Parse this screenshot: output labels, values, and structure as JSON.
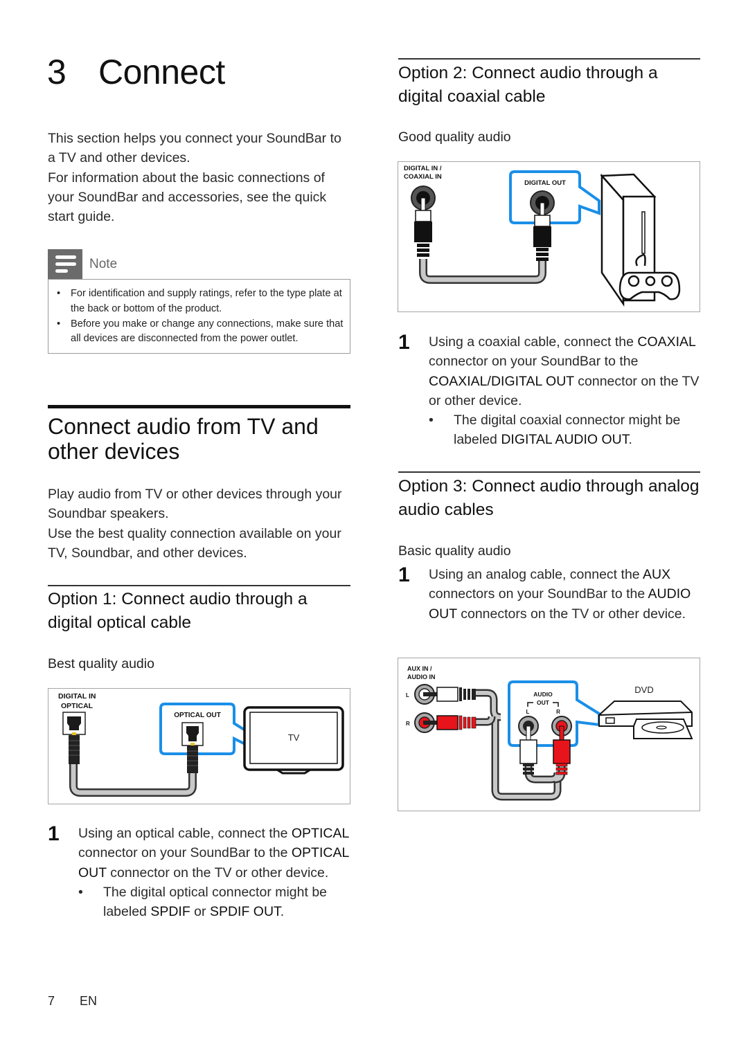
{
  "chapter": {
    "number": "3",
    "title": "Connect"
  },
  "intro": {
    "paragraph_1": "This section helps you connect your SoundBar to a TV and other devices.",
    "paragraph_2": "For information about the basic connections of your SoundBar and accessories, see the quick start guide."
  },
  "note": {
    "icon": "note-lines-icon",
    "label": "Note",
    "items": [
      "For identification and supply ratings, refer to the type plate at the back or bottom of the product.",
      "Before you make or change any connections, make sure that all devices are disconnected from the power outlet."
    ]
  },
  "section": {
    "title": "Connect audio from TV and other devices",
    "paragraph_1": "Play audio from TV or other devices through your Soundbar speakers.",
    "paragraph_2": "Use the best quality connection available on your TV, Soundbar, and other devices."
  },
  "option1": {
    "title": "Option 1: Connect audio through a digital optical cable",
    "quality": "Best quality audio",
    "figure": {
      "soundbar_label_1": "DIGITAL IN",
      "soundbar_label_2": "OPTICAL",
      "device_port_label": "OPTICAL OUT",
      "device_label": "TV",
      "highlight_color": "#1a8fe8"
    },
    "step": {
      "number": "1",
      "text_1": "Using an optical cable, connect the ",
      "key_1": "OPTICAL",
      "text_2": " connector on your SoundBar to the ",
      "key_2": "OPTICAL OUT",
      "text_3": " connector on the TV or other device."
    },
    "bullet": {
      "symbol": "•",
      "text_1": "The digital optical connector might be labeled ",
      "key_1": "SPDIF",
      "text_2": " or ",
      "key_2": "SPDIF OUT",
      "text_3": "."
    }
  },
  "option2": {
    "title": "Option 2: Connect audio through a digital coaxial cable",
    "quality": "Good quality audio",
    "figure": {
      "soundbar_label_1": "DIGITAL IN /",
      "soundbar_label_2": "COAXIAL IN",
      "device_port_label": "DIGITAL OUT",
      "device_label": "game console",
      "highlight_color": "#1a8fe8"
    },
    "step": {
      "number": "1",
      "text_1": "Using a coaxial cable, connect the ",
      "key_1": "COAXIAL",
      "text_2": " connector on your SoundBar to the ",
      "key_2": "COAXIAL/DIGITAL OUT",
      "text_3": " connector on the TV or other device."
    },
    "bullet": {
      "symbol": "•",
      "text_1": "The digital coaxial connector might be labeled ",
      "key_1": "DIGITAL AUDIO OUT",
      "text_2": "."
    }
  },
  "option3": {
    "title": "Option 3: Connect audio through analog audio cables",
    "quality": "Basic quality audio",
    "step": {
      "number": "1",
      "text_1": "Using an analog cable, connect the ",
      "key_1": "AUX",
      "text_2": " connectors on your SoundBar to the ",
      "key_2": "AUDIO OUT",
      "text_3": " connectors on the TV or other device."
    },
    "figure": {
      "soundbar_label_1": "AUX IN /",
      "soundbar_label_2": "AUDIO IN",
      "left": "L",
      "right": "R",
      "device_port_label_1": "AUDIO",
      "device_port_label_2": "OUT",
      "device_label": "DVD",
      "highlight_color": "#1a8fe8",
      "right_channel_color": "#e8141b"
    }
  },
  "footer": {
    "page": "7",
    "lang": "EN"
  }
}
